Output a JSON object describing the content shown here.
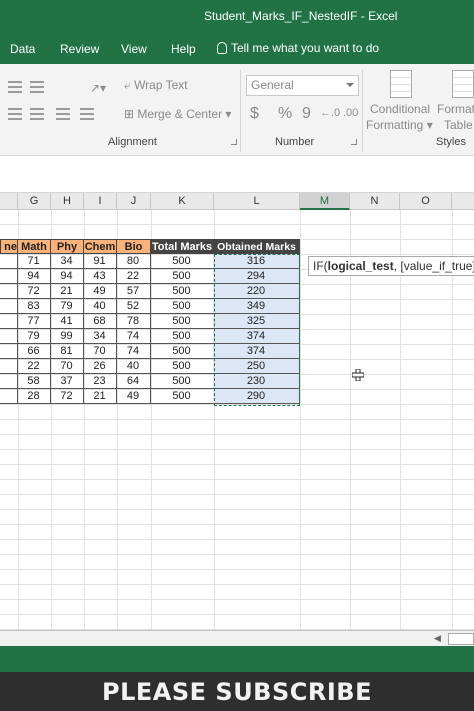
{
  "window": {
    "title": "Student_Marks_IF_NestedIF  -  Excel"
  },
  "tabs": [
    "Data",
    "Review",
    "View",
    "Help"
  ],
  "tell_me": "Tell me what you want to do",
  "ribbon": {
    "wrap_text": "Wrap Text",
    "merge_center": "Merge & Center",
    "number_format": "General",
    "currency": "$",
    "percent": "%",
    "comma": "9",
    "conditional": "Conditional",
    "formatting": "Formatting",
    "format_as": "Format",
    "table": "Table",
    "groups": {
      "alignment": "Alignment",
      "number": "Number",
      "styles": "Styles"
    }
  },
  "columns": [
    "G",
    "H",
    "I",
    "J",
    "K",
    "L",
    "M",
    "N",
    "O"
  ],
  "active_column": "M",
  "table": {
    "headers": [
      "ne",
      "Math",
      "Phy",
      "Chem",
      "Bio",
      "Total Marks",
      "Obtained Marks"
    ],
    "rows": [
      [
        "71",
        "34",
        "91",
        "80",
        "500",
        "316"
      ],
      [
        "94",
        "94",
        "43",
        "22",
        "500",
        "294"
      ],
      [
        "72",
        "21",
        "49",
        "57",
        "500",
        "220"
      ],
      [
        "83",
        "79",
        "40",
        "52",
        "500",
        "349"
      ],
      [
        "77",
        "41",
        "68",
        "78",
        "500",
        "325"
      ],
      [
        "79",
        "99",
        "34",
        "74",
        "500",
        "374"
      ],
      [
        "66",
        "81",
        "70",
        "74",
        "500",
        "374"
      ],
      [
        "22",
        "70",
        "26",
        "40",
        "500",
        "250"
      ],
      [
        "58",
        "37",
        "23",
        "64",
        "500",
        "230"
      ],
      [
        "28",
        "72",
        "21",
        "49",
        "500",
        "290"
      ]
    ]
  },
  "tooltip": {
    "fn": "IF(",
    "arg1": "logical_test",
    "rest": ", [value_if_true], ["
  },
  "banner": "PLEASE SUBSCRIBE",
  "colors": {
    "excel_green": "#217346",
    "header_orange": "#f8b27a",
    "header_dark": "#444444",
    "selection": "#dce6f5"
  }
}
